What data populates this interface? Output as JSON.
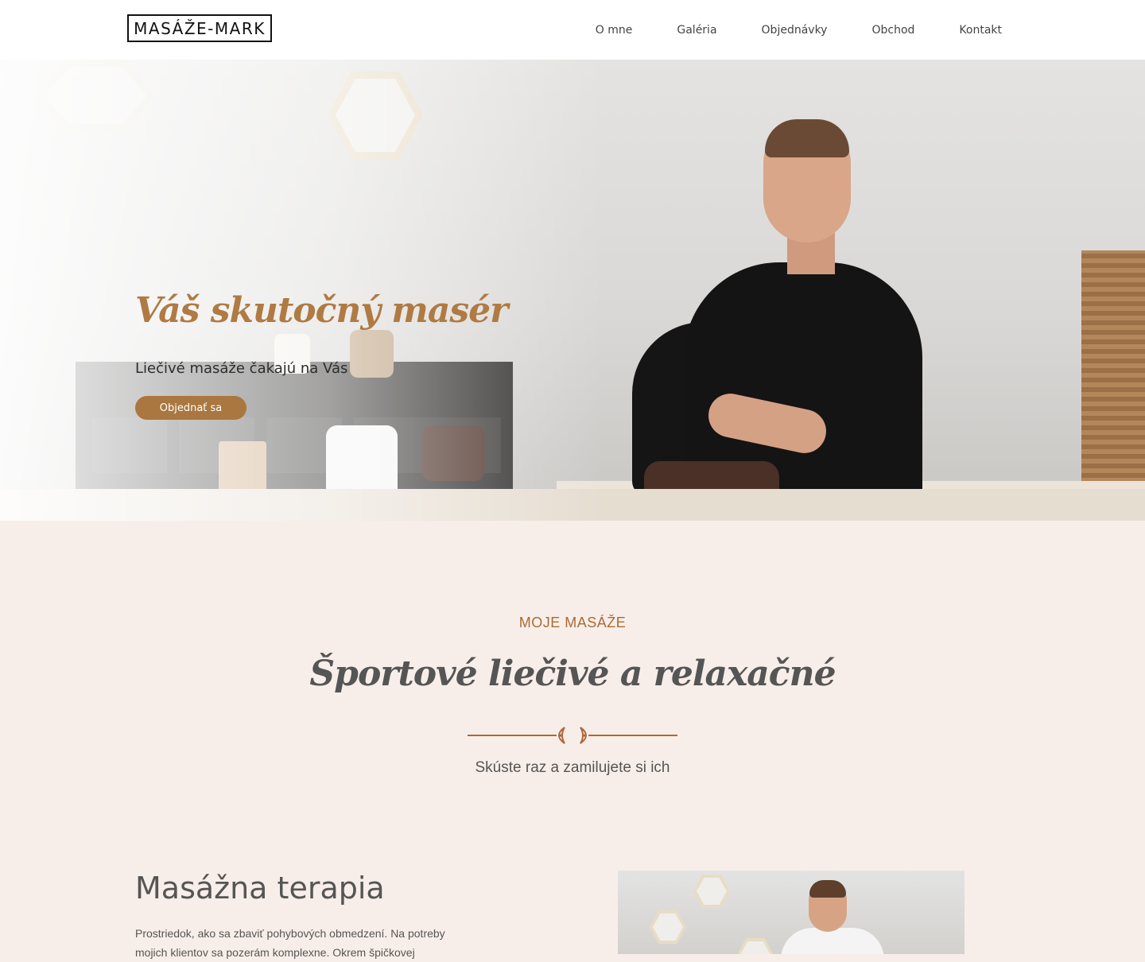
{
  "header": {
    "logo": "MASÁŽE-MARK",
    "nav": [
      "O mne",
      "Galéria",
      "Objednávky",
      "Obchod",
      "Kontakt"
    ]
  },
  "hero": {
    "title": "Váš skutočný masér",
    "subtitle": "Liečivé masáže čakajú na Vás",
    "button": "Objednať sa"
  },
  "section": {
    "kicker": "MOJE MASÁŽE",
    "title": "Športové liečivé a relaxačné",
    "subtitle": "Skúste raz a zamilujete si ich"
  },
  "therapy": {
    "title": "Masážna terapia",
    "text": "Prostriedok, ako sa zbaviť pohybových obmedzení. Na potreby mojich klientov sa pozerám komplexne. Okrem špičkovej"
  },
  "colors": {
    "accent": "#a9773f",
    "kicker": "#a96b35",
    "background": "#f8eee9"
  }
}
